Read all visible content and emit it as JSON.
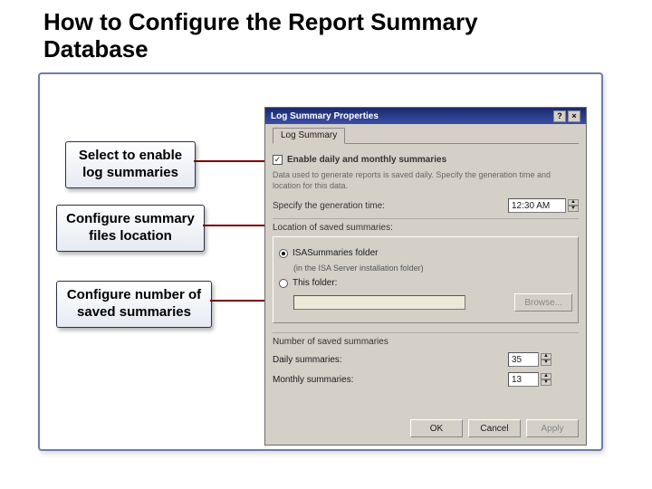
{
  "slide": {
    "title": "How to Configure the Report Summary Database"
  },
  "callouts": {
    "c1": "Select to enable log summaries",
    "c2": "Configure summary files location",
    "c3": "Configure number of saved summaries"
  },
  "dlg": {
    "title": "Log Summary Properties",
    "help_btn": "?",
    "close_btn": "×",
    "tab": "Log Summary",
    "enable_cb_label": "Enable daily and monthly summaries",
    "enable_cb_checked": "true",
    "data_text": "Data used to generate reports is saved daily. Specify the generation time and location for this data.",
    "time_label": "Specify the generation time:",
    "time_value": "12:30 AM",
    "loc_label": "Location of saved summaries:",
    "radio1_label": "ISASummaries folder",
    "radio1_sub": "(in the ISA Server installation folder)",
    "radio2_label": "This folder:",
    "browse_btn": "Browse...",
    "num_label": "Number of saved summaries",
    "daily_label": "Daily summaries:",
    "daily_value": "35",
    "monthly_label": "Monthly summaries:",
    "monthly_value": "13",
    "ok_btn": "OK",
    "cancel_btn": "Cancel",
    "apply_btn": "Apply"
  }
}
